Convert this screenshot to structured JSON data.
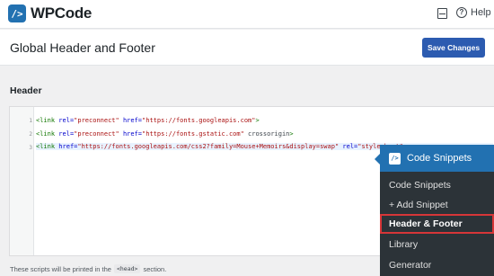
{
  "app": {
    "logo_mark": "/>",
    "name": "WPCode",
    "help_label": "Help"
  },
  "header": {
    "title": "Global Header and Footer",
    "save_label": "Save Changes"
  },
  "section": {
    "label": "Header"
  },
  "editor": {
    "lines": [
      {
        "number": "1",
        "tag_open": "<link ",
        "attr1": "rel=",
        "val1": "\"preconnect\"",
        "attr2": " href=",
        "val2": "\"https://fonts.googleapis.com\"",
        "rest": "",
        "tag_close": ">"
      },
      {
        "number": "2",
        "tag_open": "<link ",
        "attr1": "rel=",
        "val1": "\"preconnect\"",
        "attr2": " href=",
        "val2": "\"https://fonts.gstatic.com\"",
        "rest": " crossorigin",
        "tag_close": ">"
      },
      {
        "number": "3",
        "tag_open": "<link ",
        "attr1": "href=",
        "val1": "\"https://fonts.googleapis.com/css2?family=Mouse+Memoirs&display=swap\"",
        "attr2": " rel=",
        "val2": "\"stylesheet\"",
        "rest": "",
        "tag_close": ">"
      }
    ]
  },
  "footnote": {
    "before": "These scripts will be printed in the",
    "code": "<head>",
    "after": "section."
  },
  "admin_menu": {
    "heading": "Code Snippets",
    "heading_icon": "/>",
    "items": [
      {
        "label": "Code Snippets"
      },
      {
        "label": "+ Add Snippet"
      },
      {
        "label": "Header & Footer"
      },
      {
        "label": "Library"
      },
      {
        "label": "Generator"
      }
    ]
  },
  "icons": {
    "logo": "code-brackets-icon",
    "inbox": "inbox-icon",
    "help": "help-circle-icon"
  },
  "colors": {
    "accent": "#2271b1",
    "button": "#2c5bb0",
    "menu_bg": "#2c3338",
    "highlight_border": "#d63638"
  }
}
